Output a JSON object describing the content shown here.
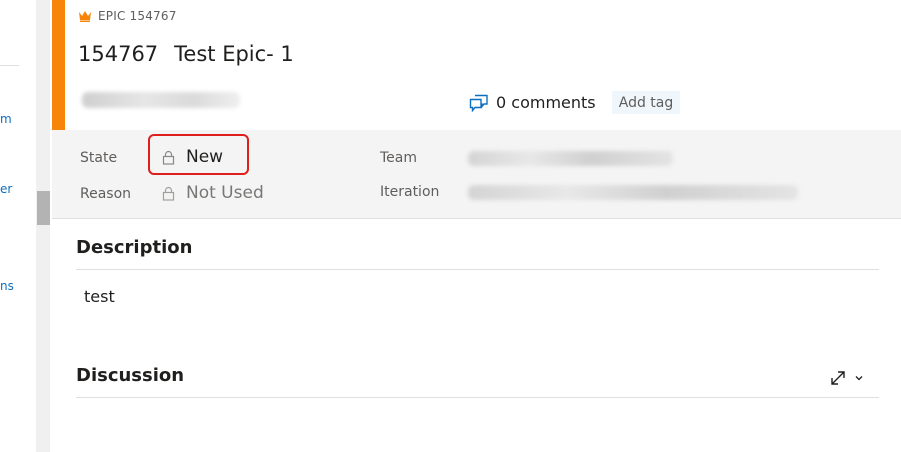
{
  "left_nav": {
    "fragments": [
      "m",
      "er",
      "ns"
    ]
  },
  "work_item": {
    "type_label": "EPIC 154767",
    "id": "154767",
    "title": "Test Epic- 1",
    "comments_label": "0 comments",
    "add_tag_label": "Add tag",
    "accent_color": "#f7850a"
  },
  "fields": {
    "state_label": "State",
    "state_value": "New",
    "reason_label": "Reason",
    "reason_value": "Not Used",
    "team_label": "Team",
    "iteration_label": "Iteration"
  },
  "description": {
    "title": "Description",
    "text": "test"
  },
  "discussion": {
    "title": "Discussion"
  },
  "icons": {
    "type": "crown-icon",
    "comments": "comments-icon",
    "lock": "lock-icon",
    "expand": "expand-icon",
    "collapse": "chevron-down-icon"
  },
  "colors": {
    "highlight": "#e01e1e",
    "link": "#106ebe",
    "tag_bg": "#eff6fc"
  }
}
